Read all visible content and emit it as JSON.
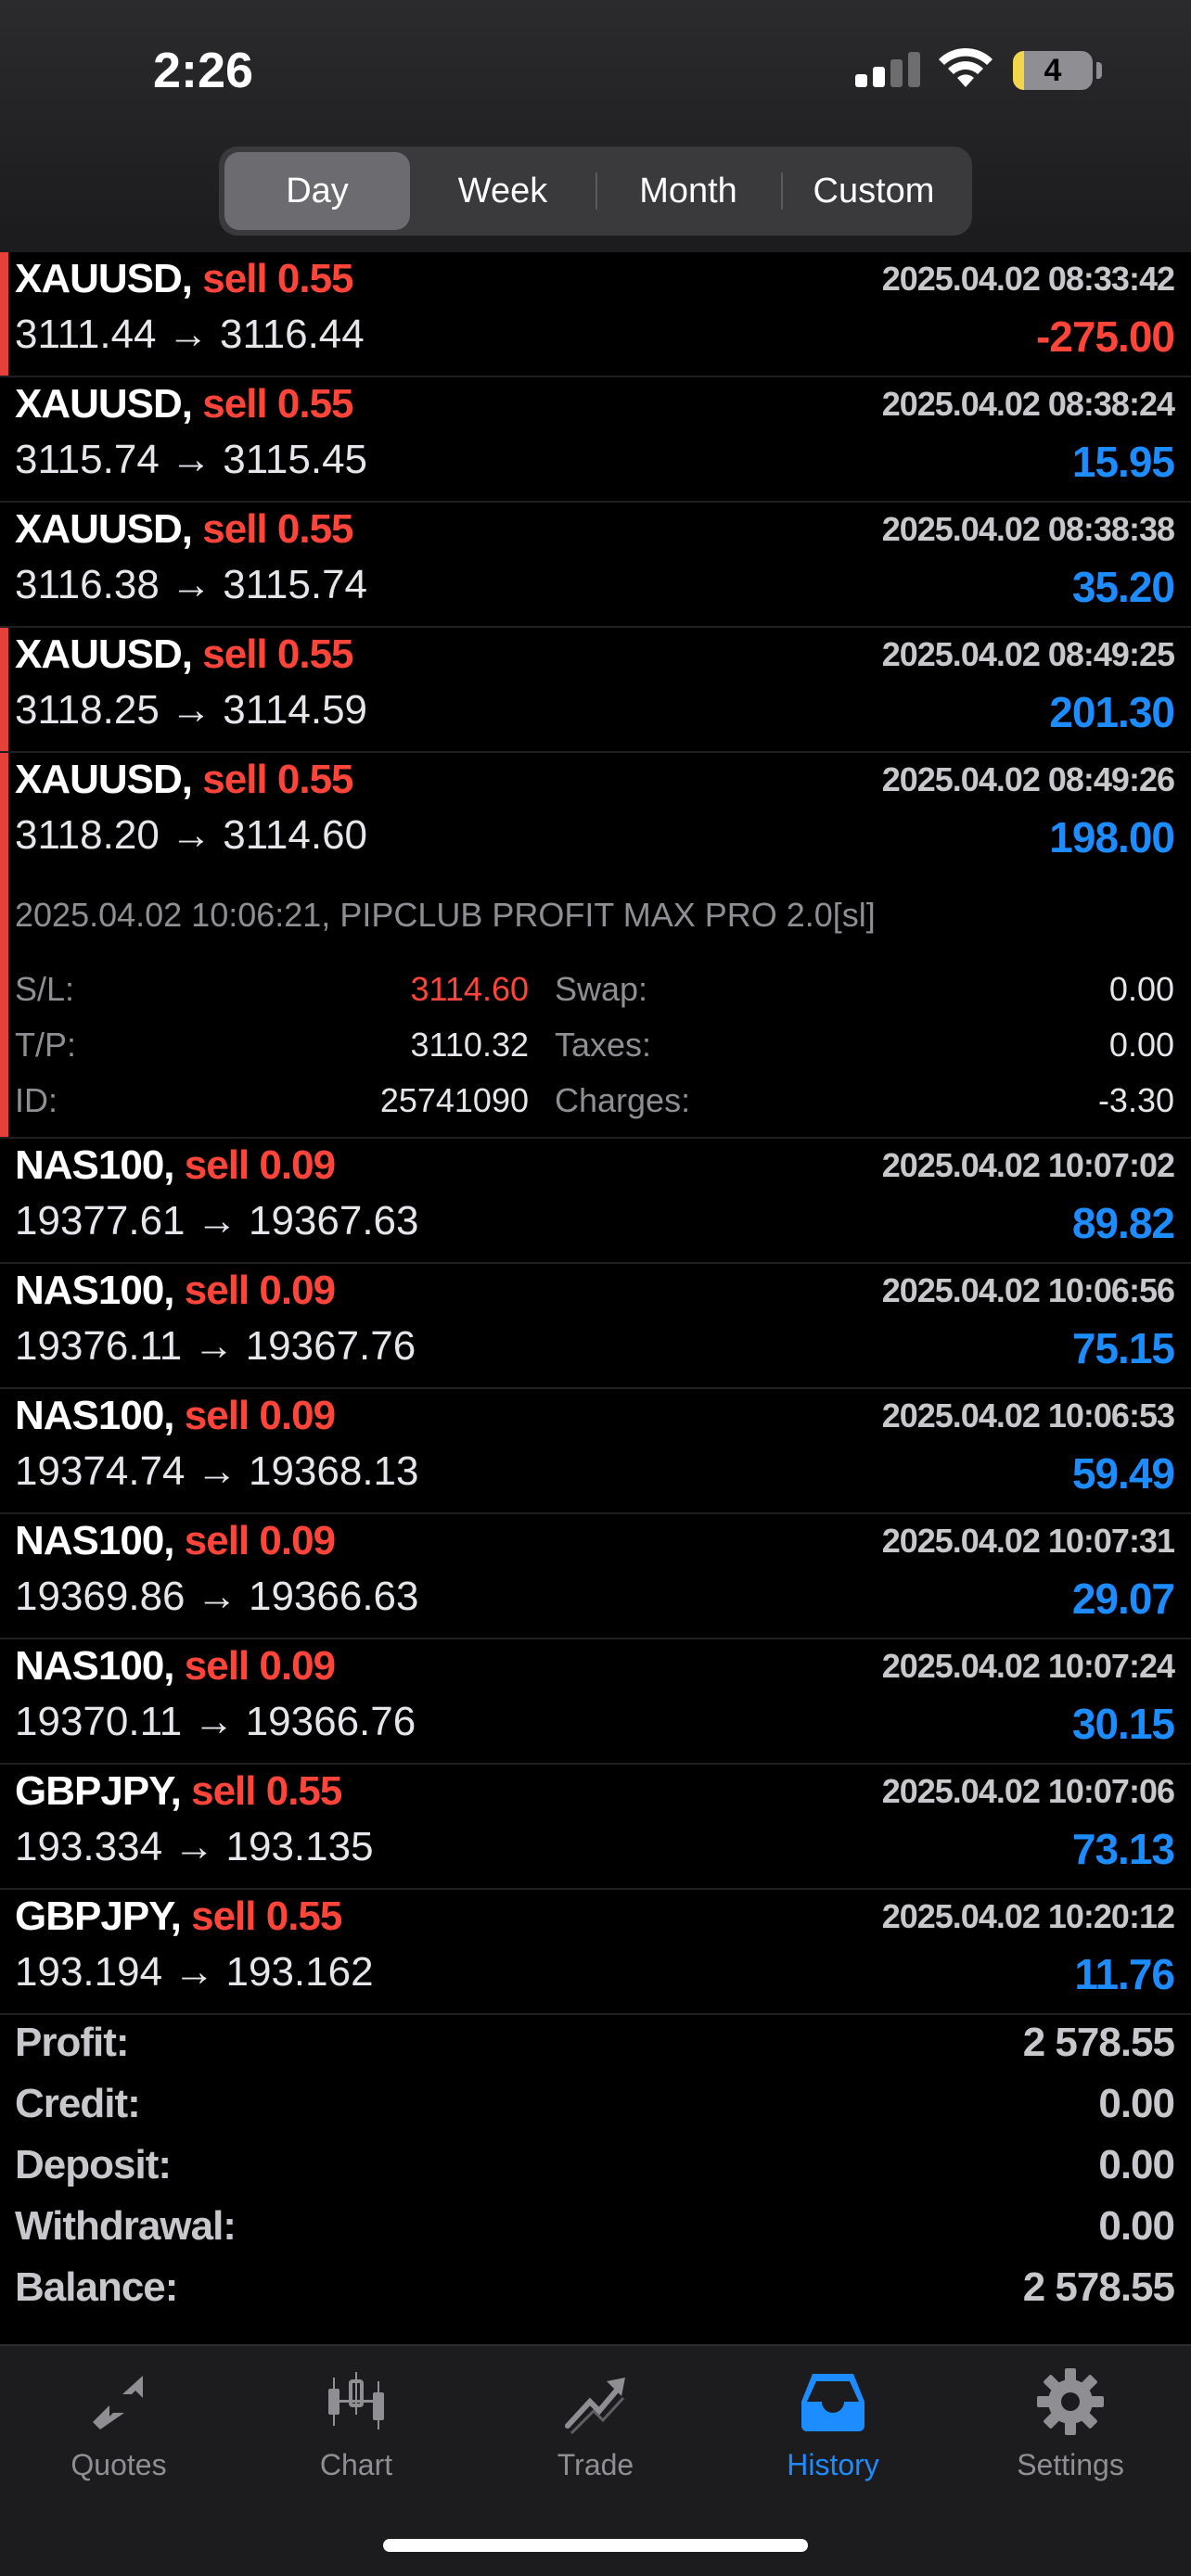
{
  "status_bar": {
    "time": "2:26",
    "battery": "4"
  },
  "period_tabs": [
    {
      "label": "Day",
      "active": true
    },
    {
      "label": "Week",
      "active": false
    },
    {
      "label": "Month",
      "active": false
    },
    {
      "label": "Custom",
      "active": false
    }
  ],
  "deals": [
    {
      "symbol": "XAUUSD,",
      "side": "sell 0.55",
      "datetime": "2025.04.02 08:33:42",
      "prices": "3111.44 → 3116.44",
      "profit": "-275.00",
      "negative": true,
      "marked": true
    },
    {
      "symbol": "XAUUSD,",
      "side": "sell 0.55",
      "datetime": "2025.04.02 08:38:24",
      "prices": "3115.74 → 3115.45",
      "profit": "15.95",
      "negative": false,
      "marked": false
    },
    {
      "symbol": "XAUUSD,",
      "side": "sell 0.55",
      "datetime": "2025.04.02 08:38:38",
      "prices": "3116.38 → 3115.74",
      "profit": "35.20",
      "negative": false,
      "marked": false
    },
    {
      "symbol": "XAUUSD,",
      "side": "sell 0.55",
      "datetime": "2025.04.02 08:49:25",
      "prices": "3118.25 → 3114.59",
      "profit": "201.30",
      "negative": false,
      "marked": true
    },
    {
      "symbol": "XAUUSD,",
      "side": "sell 0.55",
      "datetime": "2025.04.02 08:49:26",
      "prices": "3118.20 → 3114.60",
      "profit": "198.00",
      "negative": false,
      "marked": true,
      "expanded": {
        "comment": "2025.04.02 10:06:21, PIPCLUB PROFIT MAX PRO 2.0[sl]",
        "sl_label": "S/L:",
        "sl": "3114.60",
        "tp_label": "T/P:",
        "tp": "3110.32",
        "id_label": "ID:",
        "id": "25741090",
        "swap_label": "Swap:",
        "swap": "0.00",
        "taxes_label": "Taxes:",
        "taxes": "0.00",
        "charges_label": "Charges:",
        "charges": "-3.30"
      }
    },
    {
      "symbol": "NAS100,",
      "side": "sell 0.09",
      "datetime": "2025.04.02 10:07:02",
      "prices": "19377.61 → 19367.63",
      "profit": "89.82",
      "negative": false,
      "marked": false
    },
    {
      "symbol": "NAS100,",
      "side": "sell 0.09",
      "datetime": "2025.04.02 10:06:56",
      "prices": "19376.11 → 19367.76",
      "profit": "75.15",
      "negative": false,
      "marked": false
    },
    {
      "symbol": "NAS100,",
      "side": "sell 0.09",
      "datetime": "2025.04.02 10:06:53",
      "prices": "19374.74 → 19368.13",
      "profit": "59.49",
      "negative": false,
      "marked": false
    },
    {
      "symbol": "NAS100,",
      "side": "sell 0.09",
      "datetime": "2025.04.02 10:07:31",
      "prices": "19369.86 → 19366.63",
      "profit": "29.07",
      "negative": false,
      "marked": false
    },
    {
      "symbol": "NAS100,",
      "side": "sell 0.09",
      "datetime": "2025.04.02 10:07:24",
      "prices": "19370.11 → 19366.76",
      "profit": "30.15",
      "negative": false,
      "marked": false
    },
    {
      "symbol": "GBPJPY,",
      "side": "sell 0.55",
      "datetime": "2025.04.02 10:07:06",
      "prices": "193.334 → 193.135",
      "profit": "73.13",
      "negative": false,
      "marked": false
    },
    {
      "symbol": "GBPJPY,",
      "side": "sell 0.55",
      "datetime": "2025.04.02 10:20:12",
      "prices": "193.194 → 193.162",
      "profit": "11.76",
      "negative": false,
      "marked": false
    }
  ],
  "totals": [
    {
      "label": "Profit:",
      "value": "2 578.55"
    },
    {
      "label": "Credit:",
      "value": "0.00"
    },
    {
      "label": "Deposit:",
      "value": "0.00"
    },
    {
      "label": "Withdrawal:",
      "value": "0.00"
    },
    {
      "label": "Balance:",
      "value": "2 578.55"
    }
  ],
  "tabs": [
    {
      "label": "Quotes",
      "icon": "quotes-icon",
      "active": false
    },
    {
      "label": "Chart",
      "icon": "chart-icon",
      "active": false
    },
    {
      "label": "Trade",
      "icon": "trade-icon",
      "active": false
    },
    {
      "label": "History",
      "icon": "history-icon",
      "active": true
    },
    {
      "label": "Settings",
      "icon": "gear-icon",
      "active": false
    }
  ],
  "colors": {
    "profit": "#1c8cff",
    "loss": "#ff453a",
    "accent": "#1c8cff"
  }
}
